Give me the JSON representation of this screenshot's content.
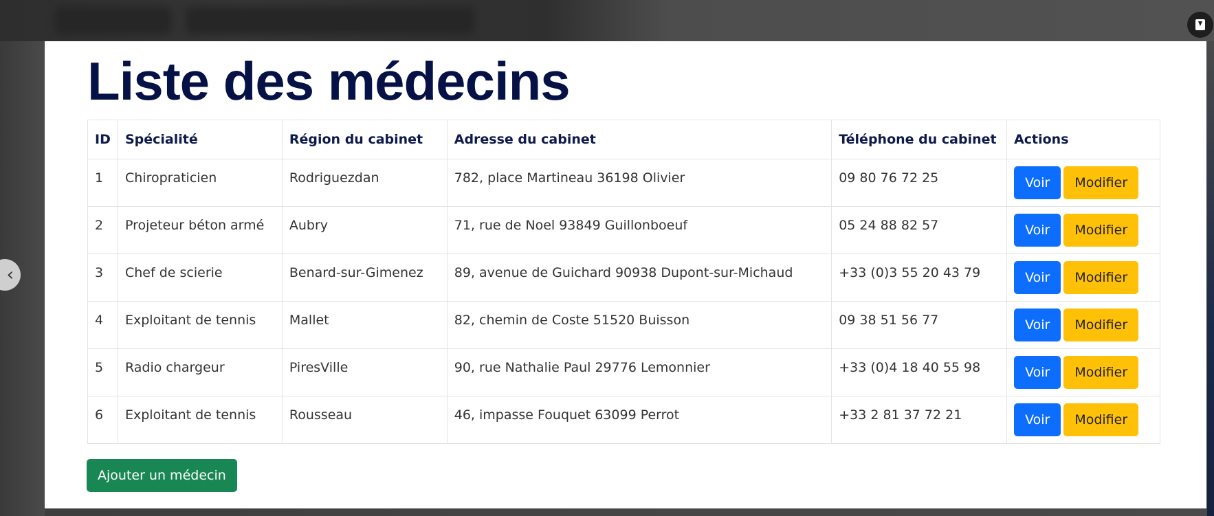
{
  "page": {
    "title": "Liste des médecins",
    "add_button_label": "Ajouter un médecin"
  },
  "table": {
    "headers": {
      "id": "ID",
      "specialite": "Spécialité",
      "region": "Région du cabinet",
      "adresse": "Adresse du cabinet",
      "telephone": "Téléphone du cabinet",
      "actions": "Actions"
    },
    "rows": [
      {
        "id": "1",
        "specialite": "Chiropraticien",
        "region": "Rodriguezdan",
        "adresse": "782, place Martineau 36198 Olivier",
        "telephone": "09 80 76 72 25"
      },
      {
        "id": "2",
        "specialite": "Projeteur béton armé",
        "region": "Aubry",
        "adresse": "71, rue de Noel 93849 Guillonboeuf",
        "telephone": "05 24 88 82 57"
      },
      {
        "id": "3",
        "specialite": "Chef de scierie",
        "region": "Benard-sur-Gimenez",
        "adresse": "89, avenue de Guichard 90938 Dupont-sur-Michaud",
        "telephone": "+33 (0)3 55 20 43 79"
      },
      {
        "id": "4",
        "specialite": "Exploitant de tennis",
        "region": "Mallet",
        "adresse": "82, chemin de Coste 51520 Buisson",
        "telephone": "09 38 51 56 77"
      },
      {
        "id": "5",
        "specialite": "Radio chargeur",
        "region": "PiresVille",
        "adresse": "90, rue Nathalie Paul 29776 Lemonnier",
        "telephone": "+33 (0)4 18 40 55 98"
      },
      {
        "id": "6",
        "specialite": "Exploitant de tennis",
        "region": "Rousseau",
        "adresse": "46, impasse Fouquet 63099 Perrot",
        "telephone": "+33 2 81 37 72 21"
      }
    ],
    "actions": {
      "view_label": "Voir",
      "edit_label": "Modifier"
    }
  },
  "icons": {
    "download": "download-icon",
    "previous": "chevron-left-icon"
  },
  "colors": {
    "title": "#061246",
    "view_button": "#0d6efd",
    "edit_button": "#ffc107",
    "add_button": "#198754"
  }
}
